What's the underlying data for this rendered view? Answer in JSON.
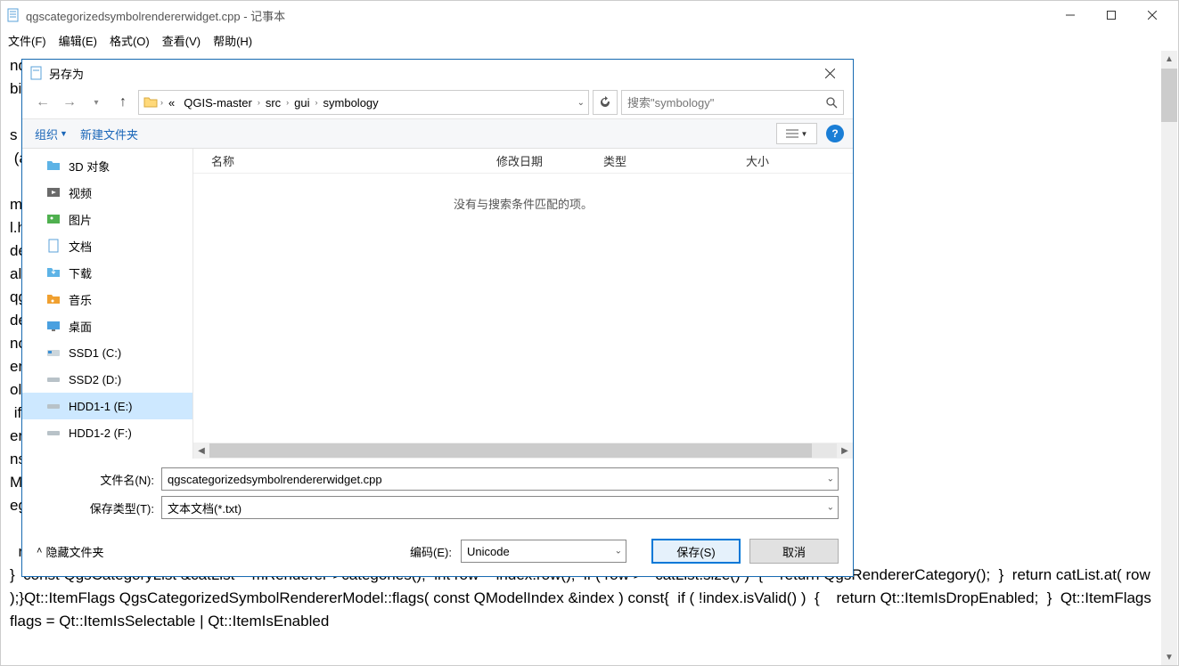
{
  "notepad": {
    "title": "qgscategorizedsymbolrendererwidget.cpp - 记事本",
    "menus": {
      "file": "文件(F)",
      "edit": "编辑(E)",
      "format": "格式(O)",
      "view": "查看(V)",
      "help": "帮助(H)"
    },
    "content": "ndererwidget.cpp\nbias    email               : wonder dot\n\ns of the GNU General Public\n (at your option) any later\n\nmbolrendererwidget.h\"#include\nl.h\"#include\nde \"qgscolorramp.h\"#include\nalog.h\"#include\nqgsproject.h\"#include\nde <QMenu>#include\nnclude <QPainter>#include\nendererModel( QObject *parent ) :\nolrendererv2model\" ) ){}void\n if ( mRenderer )  {\nerer = nullptr;    endRemoveRows\nnsertRows( QModelIndex(), 0,\nModel::addCategory( const\neginInsertRows( QModelIndex(),\n\n  return QgsRendererCategory();\n}  const QgsCategoryList &catList = mRenderer->categories();  int row = index.row();  if ( row >= catList.size() )  {    return QgsRendererCategory();  }  return catList.at( row );}Qt::ItemFlags QgsCategorizedSymbolRendererModel::flags( const QModelIndex &index ) const{  if ( !index.isValid() )  {    return Qt::ItemIsDropEnabled;  }  Qt::ItemFlags flags = Qt::ItemIsSelectable | Qt::ItemIsEnabled"
  },
  "saveAs": {
    "title": "另存为",
    "breadcrumb": {
      "prefix": "«",
      "items": [
        "QGIS-master",
        "src",
        "gui",
        "symbology"
      ]
    },
    "searchPlaceholder": "搜索\"symbology\"",
    "toolbar": {
      "organize": "组织",
      "newFolder": "新建文件夹"
    },
    "tree": [
      {
        "label": "3D 对象",
        "icon": "folder-3d"
      },
      {
        "label": "视频",
        "icon": "folder-video"
      },
      {
        "label": "图片",
        "icon": "folder-pictures"
      },
      {
        "label": "文档",
        "icon": "folder-docs"
      },
      {
        "label": "下载",
        "icon": "folder-downloads"
      },
      {
        "label": "音乐",
        "icon": "folder-music"
      },
      {
        "label": "桌面",
        "icon": "folder-desktop"
      },
      {
        "label": "SSD1 (C:)",
        "icon": "drive-ssd"
      },
      {
        "label": "SSD2 (D:)",
        "icon": "drive"
      },
      {
        "label": "HDD1-1 (E:)",
        "icon": "drive",
        "selected": true
      },
      {
        "label": "HDD1-2 (F:)",
        "icon": "drive"
      }
    ],
    "columns": {
      "name": "名称",
      "modified": "修改日期",
      "type": "类型",
      "size": "大小"
    },
    "emptyMessage": "没有与搜索条件匹配的项。",
    "fileNameLabel": "文件名(N):",
    "fileNameValue": "qgscategorizedsymbolrendererwidget.cpp",
    "saveTypeLabel": "保存类型(T):",
    "saveTypeValue": "文本文档(*.txt)",
    "hideFolders": "隐藏文件夹",
    "encodingLabel": "编码(E):",
    "encodingValue": "Unicode",
    "saveButton": "保存(S)",
    "cancelButton": "取消"
  }
}
